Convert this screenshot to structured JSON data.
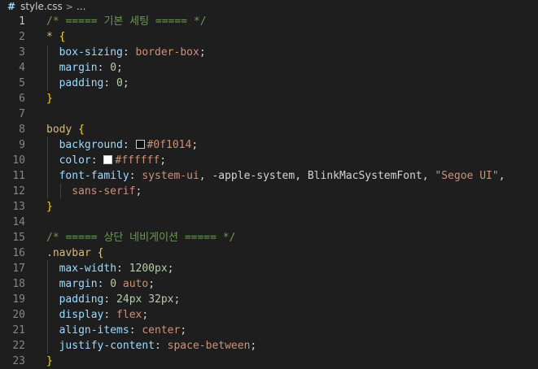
{
  "breadcrumb": {
    "icon": "css-hash-icon",
    "file": "style.css",
    "separator": ">",
    "rest": "..."
  },
  "lines": [
    {
      "n": "1",
      "tokens": [
        {
          "t": "/* ===== 기본 세팅 ===== */",
          "c": "comment"
        }
      ]
    },
    {
      "n": "2",
      "tokens": [
        {
          "t": "* ",
          "c": "selector"
        },
        {
          "t": "{",
          "c": "brace"
        }
      ]
    },
    {
      "n": "3",
      "tokens": [
        {
          "t": "box-sizing",
          "c": "prop"
        },
        {
          "t": ": ",
          "c": "punc"
        },
        {
          "t": "border-box",
          "c": "value"
        },
        {
          "t": ";",
          "c": "punc"
        }
      ]
    },
    {
      "n": "4",
      "tokens": [
        {
          "t": "margin",
          "c": "prop"
        },
        {
          "t": ": ",
          "c": "punc"
        },
        {
          "t": "0",
          "c": "num"
        },
        {
          "t": ";",
          "c": "punc"
        }
      ]
    },
    {
      "n": "5",
      "tokens": [
        {
          "t": "padding",
          "c": "prop"
        },
        {
          "t": ": ",
          "c": "punc"
        },
        {
          "t": "0",
          "c": "num"
        },
        {
          "t": ";",
          "c": "punc"
        }
      ]
    },
    {
      "n": "6",
      "tokens": [
        {
          "t": "}",
          "c": "brace"
        }
      ]
    },
    {
      "n": "7",
      "tokens": []
    },
    {
      "n": "8",
      "tokens": [
        {
          "t": "body ",
          "c": "selector"
        },
        {
          "t": "{",
          "c": "brace"
        }
      ]
    },
    {
      "n": "9",
      "tokens": [
        {
          "t": "background",
          "c": "prop"
        },
        {
          "t": ": ",
          "c": "punc"
        },
        {
          "swatch": "#0f1014"
        },
        {
          "t": "#0f1014",
          "c": "value"
        },
        {
          "t": ";",
          "c": "punc"
        }
      ]
    },
    {
      "n": "10",
      "tokens": [
        {
          "t": "color",
          "c": "prop"
        },
        {
          "t": ": ",
          "c": "punc"
        },
        {
          "swatch": "#ffffff"
        },
        {
          "t": "#ffffff",
          "c": "value"
        },
        {
          "t": ";",
          "c": "punc"
        }
      ]
    },
    {
      "n": "11",
      "tokens": [
        {
          "t": "font-family",
          "c": "prop"
        },
        {
          "t": ": ",
          "c": "punc"
        },
        {
          "t": "system-ui",
          "c": "value"
        },
        {
          "t": ", ",
          "c": "punc"
        },
        {
          "t": "-apple-system",
          "c": "ident"
        },
        {
          "t": ", ",
          "c": "punc"
        },
        {
          "t": "BlinkMacSystemFont",
          "c": "ident"
        },
        {
          "t": ", ",
          "c": "punc"
        },
        {
          "t": "\"Segoe UI\"",
          "c": "string"
        },
        {
          "t": ",",
          "c": "punc"
        }
      ]
    },
    {
      "n": "12",
      "tokens": [
        {
          "t": "sans-serif",
          "c": "value"
        },
        {
          "t": ";",
          "c": "punc"
        }
      ]
    },
    {
      "n": "13",
      "tokens": [
        {
          "t": "}",
          "c": "brace"
        }
      ]
    },
    {
      "n": "14",
      "tokens": []
    },
    {
      "n": "15",
      "tokens": [
        {
          "t": "/* ===== 상단 네비게이션 ===== */",
          "c": "comment"
        }
      ]
    },
    {
      "n": "16",
      "tokens": [
        {
          "t": ".navbar ",
          "c": "selector"
        },
        {
          "t": "{",
          "c": "brace"
        }
      ]
    },
    {
      "n": "17",
      "tokens": [
        {
          "t": "max-width",
          "c": "prop"
        },
        {
          "t": ": ",
          "c": "punc"
        },
        {
          "t": "1200px",
          "c": "num"
        },
        {
          "t": ";",
          "c": "punc"
        }
      ]
    },
    {
      "n": "18",
      "tokens": [
        {
          "t": "margin",
          "c": "prop"
        },
        {
          "t": ": ",
          "c": "punc"
        },
        {
          "t": "0",
          "c": "num"
        },
        {
          "t": " ",
          "c": "punc"
        },
        {
          "t": "auto",
          "c": "value"
        },
        {
          "t": ";",
          "c": "punc"
        }
      ]
    },
    {
      "n": "19",
      "tokens": [
        {
          "t": "padding",
          "c": "prop"
        },
        {
          "t": ": ",
          "c": "punc"
        },
        {
          "t": "24px",
          "c": "num"
        },
        {
          "t": " ",
          "c": "punc"
        },
        {
          "t": "32px",
          "c": "num"
        },
        {
          "t": ";",
          "c": "punc"
        }
      ]
    },
    {
      "n": "20",
      "tokens": [
        {
          "t": "display",
          "c": "prop"
        },
        {
          "t": ": ",
          "c": "punc"
        },
        {
          "t": "flex",
          "c": "value"
        },
        {
          "t": ";",
          "c": "punc"
        }
      ]
    },
    {
      "n": "21",
      "tokens": [
        {
          "t": "align-items",
          "c": "prop"
        },
        {
          "t": ": ",
          "c": "punc"
        },
        {
          "t": "center",
          "c": "value"
        },
        {
          "t": ";",
          "c": "punc"
        }
      ]
    },
    {
      "n": "22",
      "tokens": [
        {
          "t": "justify-content",
          "c": "prop"
        },
        {
          "t": ": ",
          "c": "punc"
        },
        {
          "t": "space-between",
          "c": "value"
        },
        {
          "t": ";",
          "c": "punc"
        }
      ]
    },
    {
      "n": "23",
      "tokens": [
        {
          "t": "}",
          "c": "brace"
        }
      ]
    }
  ],
  "active_line": "1",
  "colors": {
    "background": "#1e1e1e",
    "comment": "#6a9955",
    "selector": "#d7ba7d",
    "brace": "#ffd700",
    "property": "#9cdcfe",
    "value": "#ce9178",
    "number": "#b5cea8"
  }
}
